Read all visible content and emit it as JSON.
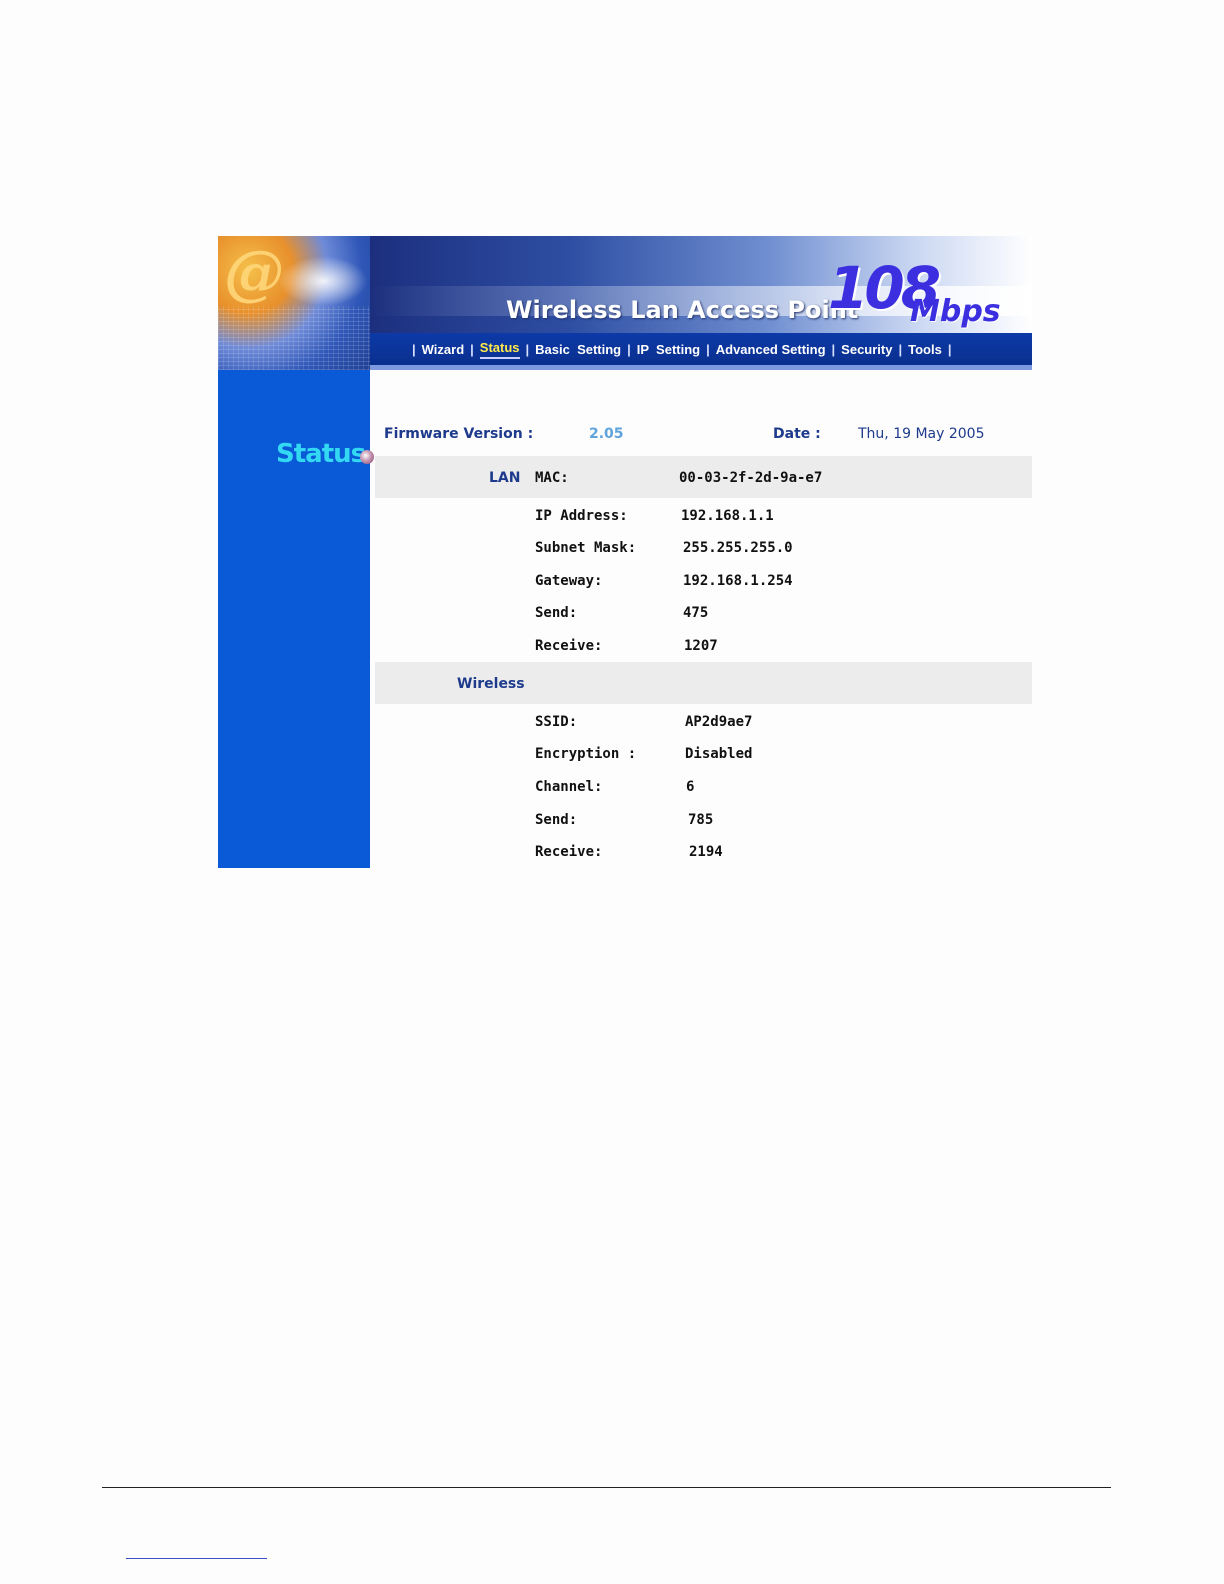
{
  "header": {
    "title": "Wireless Lan Access Point",
    "speed": "108",
    "speed_unit": "Mbps"
  },
  "nav": {
    "items": [
      {
        "label": "Wizard"
      },
      {
        "label": "Status"
      },
      {
        "label": "Basic  Setting"
      },
      {
        "label": "IP  Setting"
      },
      {
        "label": "Advanced Setting"
      },
      {
        "label": "Security"
      },
      {
        "label": "Tools"
      }
    ],
    "active": "Status",
    "separator": "|"
  },
  "sidebar": {
    "page_label": "Status",
    "logo_glyph": "@"
  },
  "info": {
    "firmware_label": "Firmware Version :",
    "firmware_value": "2.05",
    "date_label": "Date :",
    "date_value": "Thu, 19 May 2005"
  },
  "lan": {
    "section_label": "LAN",
    "rows": [
      {
        "label": "MAC:",
        "value": "00-03-2f-2d-9a-e7"
      },
      {
        "label": "IP Address:",
        "value": "192.168.1.1"
      },
      {
        "label": "Subnet Mask:",
        "value": "255.255.255.0"
      },
      {
        "label": "Gateway:",
        "value": "192.168.1.254"
      },
      {
        "label": "Send:",
        "value": "475"
      },
      {
        "label": "Receive:",
        "value": "1207"
      }
    ]
  },
  "wireless": {
    "section_label": "Wireless",
    "rows": [
      {
        "label": "SSID:",
        "value": "AP2d9ae7"
      },
      {
        "label": "Encryption :",
        "value": "Disabled"
      },
      {
        "label": "Channel:",
        "value": "6"
      },
      {
        "label": "Send:",
        "value": "785"
      },
      {
        "label": "Receive:",
        "value": "2194"
      }
    ]
  },
  "colors": {
    "sidebar": "#0a5ad8",
    "navbar": "#0d3aa8",
    "active_nav": "#ffe94a",
    "label_text": "#1d3a8c",
    "firmware_value": "#5ea3dc",
    "section_band": "#ececec"
  },
  "icons": {
    "status_indicator": "status-dot-icon",
    "logo": "at-sign-logo-icon"
  }
}
